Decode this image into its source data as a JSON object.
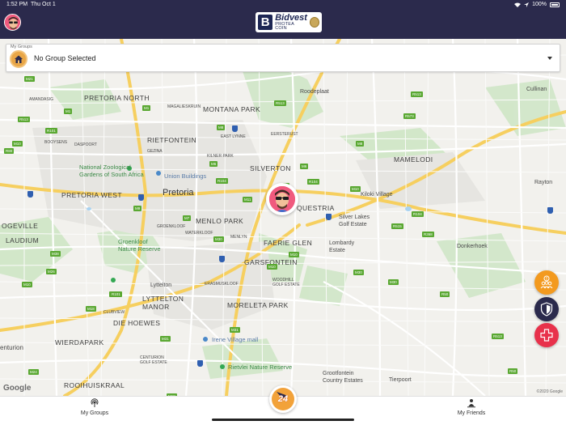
{
  "status_bar": {
    "time": "1:52 PM",
    "date": "Thu Oct 1",
    "battery": "100%"
  },
  "header": {
    "brand_title": "Bidvest",
    "brand_subtitle": "PROTEA COIN",
    "brand_mark": "B"
  },
  "group_select": {
    "caption": "My Groups",
    "value": "No Group Selected"
  },
  "map": {
    "places": {
      "pretoria_north": "PRETORIA NORTH",
      "montana_park": "MONTANA PARK",
      "roodeplaat": "Roodeplaat",
      "rietfontein": "RIETFONTEIN",
      "mamelodi": "MAMELODI",
      "silverton": "SILVERTON",
      "pretoria_west": "PRETORIA WEST",
      "pretoria": "Pretoria",
      "menlo_park": "MENLO PARK",
      "questria": "QUESTRIA",
      "faerie_glen": "FAERIE GLEN",
      "garsfontein": "GARSFONTEIN",
      "laudium": "LAUDIUM",
      "lyttelton_manor": "LYTTELTON\nMANOR",
      "moreleta_park": "MORELETA PARK",
      "die_hoewes": "DIE HOEWES",
      "wierdapark": "WIERDAPARK",
      "rooihuiskraal": "ROOIHUISKRAAL",
      "centurion": "enturion",
      "ogeville": "OGEVILLE",
      "cullinan": "Cullinan",
      "rayton": "Rayton",
      "donkerhoek": "Donkerhoek",
      "tierpoort": "Tierpoort",
      "grootfontein": "Grootfontein\nCountry Estates",
      "kiloki": "Kiloki Village",
      "silver_lakes": "Silver Lakes\nGolf Estate",
      "lombardy": "Lombardy\nEstate",
      "lyttelton": "Lyttelton",
      "zoo": "National Zoological\nGardens of South Africa",
      "union": "Union Buildings",
      "groenkloof": "Groenkloof\nNature Reserve",
      "irene": "Irene Village mall",
      "rietvlei": "Rietvlei Nature Reserve",
      "gezina": "GEZINA",
      "kilner": "KILNER PARK",
      "east_lynne": "EAST LYNNE",
      "eersterust": "EERSTERUST",
      "magalieskruin": "MAGALIESKRUIN",
      "amandasig": "AMANDASIG",
      "booysens": "BOOYSENS",
      "daspoort": "DASPOORT",
      "waterkloof": "WATERKLOOF",
      "menlyn": "MENLYN",
      "erasmuskloof": "ERASMUSKLOOF",
      "woodhill": "WOODHILL\nGOLF ESTATE",
      "clubview": "CLUBVIEW",
      "groenkloof_small": "GROENKLOOF",
      "centurion_small": "CENTURION\nGOLF ESTATE"
    },
    "google_label": "Google",
    "copyright": "©2020 Google"
  },
  "bottom_nav": {
    "left_label": "My Groups",
    "right_label": "My Friends",
    "center_label": "24"
  },
  "colors": {
    "header_bg": "#2b2a4c",
    "groups_fab": "#f39a1f",
    "shield_fab": "#2b2a4c",
    "medical_fab": "#e8314b",
    "map_bg": "#f2f1ed",
    "road_badge": "#5aa832"
  },
  "icons": {
    "profile": "avatar-icon",
    "group": "home-group-icon",
    "dropdown": "chevron-down-icon",
    "fab_groups": "group-alert-icon",
    "fab_shield": "shield-icon",
    "fab_medical": "medical-cross-icon",
    "nav_groups": "broadcast-icon",
    "nav_friends": "friends-icon",
    "center": "panic-24-icon"
  }
}
